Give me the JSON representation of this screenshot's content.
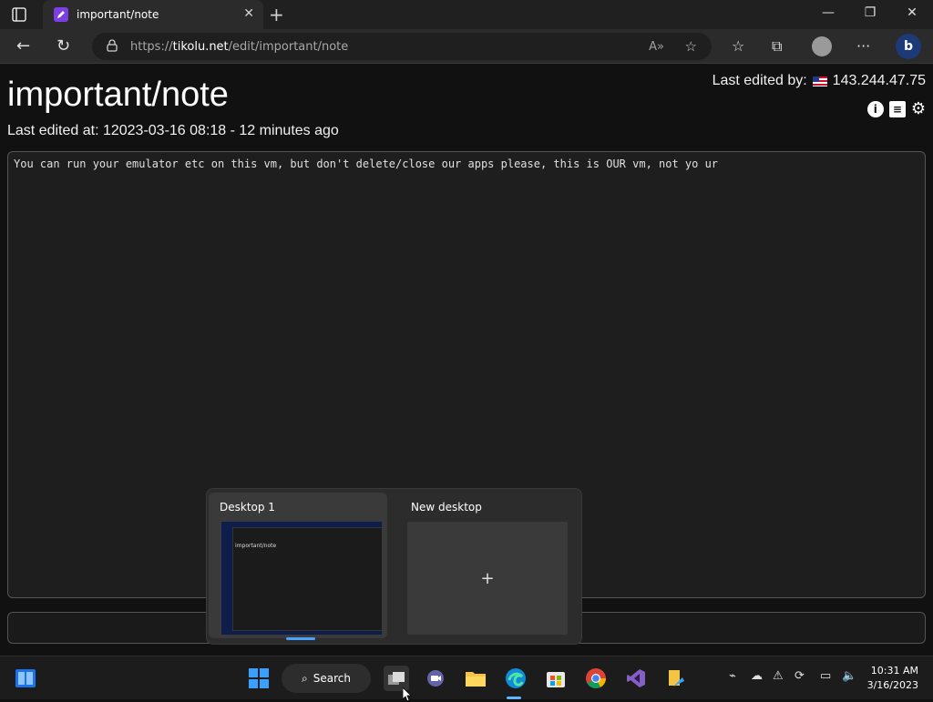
{
  "browser": {
    "tab_title": "important/note",
    "url_scheme": "https://",
    "url_host": "tikolu.net",
    "url_path": "/edit/important/note"
  },
  "page": {
    "title": "important/note",
    "last_edited_at": "Last edited at: 12023-03-16  08:18 - 12 minutes ago",
    "last_edited_by_label": "Last edited by:",
    "last_edited_by_ip": "143.244.47.75",
    "note_text": "You can run your emulator etc on this vm, but don't delete/close our apps please, this is OUR vm, not yo ur"
  },
  "task_view": {
    "desktops": [
      {
        "label": "Desktop 1"
      },
      {
        "label": "New desktop"
      }
    ],
    "thumb_title": "important/note"
  },
  "taskbar": {
    "search_label": "Search",
    "time": "10:31 AM",
    "date": "3/16/2023"
  },
  "colors": {
    "accent": "#4aa3ff",
    "page_bg": "#111111",
    "favicon": "#7b3fe4"
  }
}
